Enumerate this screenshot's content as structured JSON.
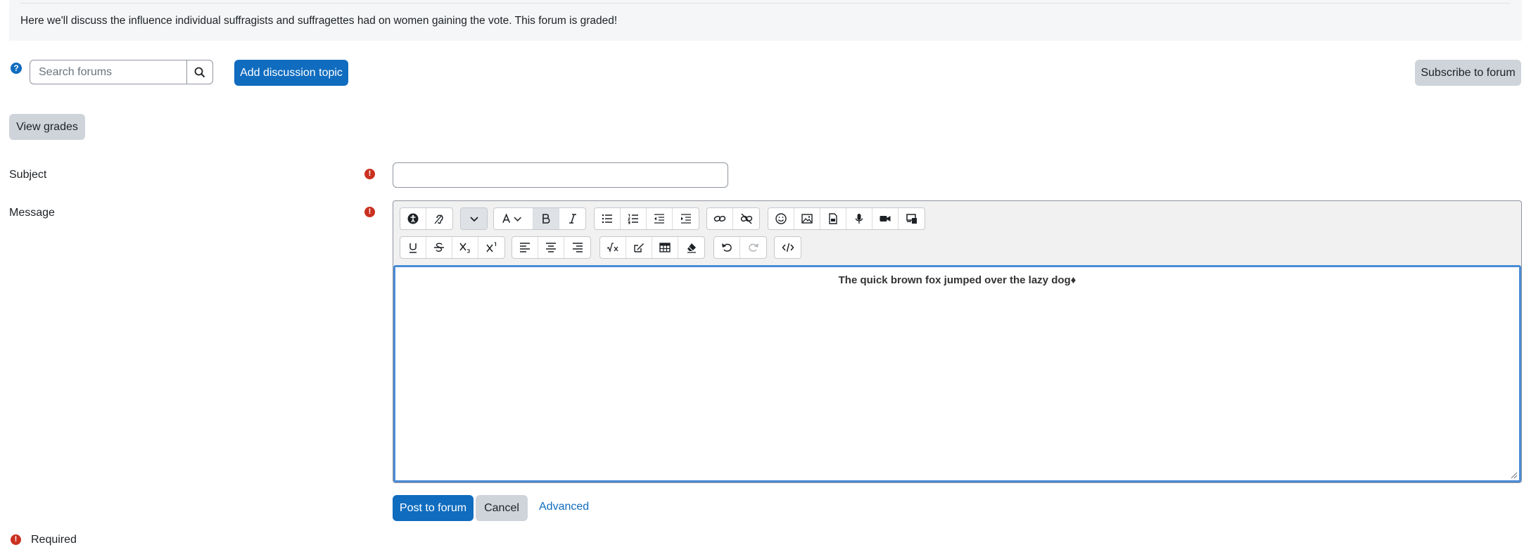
{
  "intro": {
    "text": "Here we'll discuss the influence individual suffragists and suffragettes had on women gaining the vote. This forum is graded!"
  },
  "toolbar": {
    "help_icon_glyph": "?",
    "search_placeholder": "Search forums",
    "add_topic_label": "Add discussion topic",
    "subscribe_label": "Subscribe to forum",
    "view_grades_label": "View grades"
  },
  "form": {
    "subject_label": "Subject",
    "message_label": "Message",
    "required_glyph": "!",
    "subject_value": "",
    "message_content": "The quick brown fox jumped over the lazy dog♦",
    "post_label": "Post to forum",
    "cancel_label": "Cancel",
    "advanced_label": "Advanced",
    "required_note": "Required"
  },
  "editor_toolbar": {
    "row1": [
      [
        "accessibility-checker-icon",
        "screenreader-helper-icon"
      ],
      [
        "show-more-buttons-icon"
      ],
      [
        "paragraph-styles-icon",
        "bold-icon",
        "italic-icon"
      ],
      [
        "unordered-list-icon",
        "ordered-list-icon",
        "outdent-icon",
        "indent-icon"
      ],
      [
        "link-icon",
        "unlink-icon"
      ],
      [
        "emoji-icon",
        "image-icon",
        "media-file-icon",
        "record-audio-icon",
        "record-video-icon",
        "manage-files-icon"
      ]
    ],
    "row2": [
      [
        "underline-icon",
        "strikethrough-icon",
        "subscript-icon",
        "superscript-icon"
      ],
      [
        "align-left-icon",
        "align-center-icon",
        "align-right-icon"
      ],
      [
        "equation-icon",
        "special-chars-icon",
        "table-icon",
        "clear-formatting-icon"
      ],
      [
        "undo-icon",
        "redo-icon"
      ],
      [
        "html-source-icon"
      ]
    ]
  },
  "colors": {
    "primary": "#0f6cbf",
    "secondary": "#ced4da",
    "required": "#ca3120",
    "focus": "#4a8cd6"
  }
}
